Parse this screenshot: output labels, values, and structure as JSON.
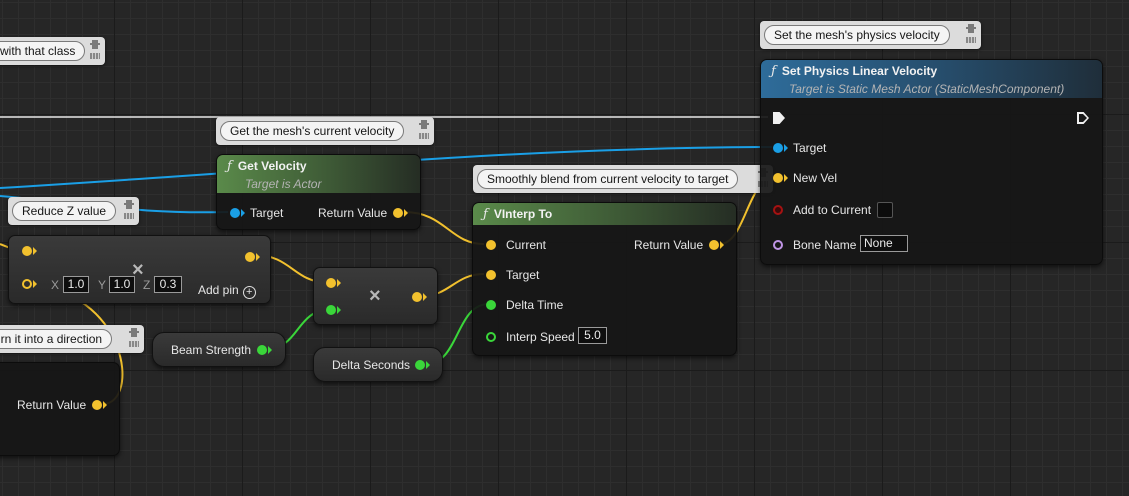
{
  "comments": {
    "with_class": "with that class",
    "set_velocity": "Set the mesh's physics velocity",
    "get_velocity": "Get the mesh's current velocity",
    "reduce_z": "Reduce Z value",
    "smooth_blend": "Smoothly blend from current velocity to target",
    "direction": "urn it into a direction"
  },
  "nodes": {
    "set_physics": {
      "title": "Set Physics Linear Velocity",
      "subtitle": "Target is Static Mesh Actor (StaticMeshComponent)",
      "pins": {
        "target": "Target",
        "new_vel": "New Vel",
        "add_to_current": "Add to Current",
        "bone_name": "Bone Name",
        "bone_name_value": "None"
      }
    },
    "get_velocity": {
      "title": "Get Velocity",
      "subtitle": "Target is Actor",
      "pins": {
        "target": "Target",
        "return_value": "Return Value"
      }
    },
    "vinterp": {
      "title": "VInterp To",
      "pins": {
        "current": "Current",
        "target": "Target",
        "delta_time": "Delta Time",
        "interp_speed": "Interp Speed",
        "interp_speed_value": "5.0",
        "return_value": "Return Value"
      }
    },
    "multiply_vector": {
      "glyph": "×",
      "x_letter": "X",
      "x_value": "1.0",
      "y_letter": "Y",
      "y_value": "1.0",
      "z_letter": "Z",
      "z_value": "0.3",
      "add_pin": "Add pin",
      "add_pin_icon": "⊕"
    },
    "multiply_float": {
      "glyph": "×"
    },
    "beam_strength": {
      "label": "Beam Strength"
    },
    "delta_seconds": {
      "label": "Delta Seconds"
    },
    "normalize": {
      "return_value": "Return Value"
    }
  },
  "colors": {
    "object_pin": "#1a9fe6",
    "vector_pin": "#f2c12e",
    "float_pin": "#3ad63a",
    "bool_pin": "#a51212",
    "name_pin": "#c095e6",
    "function_header": "#5a8a4a",
    "target_function_header": "#2e6c9a"
  }
}
